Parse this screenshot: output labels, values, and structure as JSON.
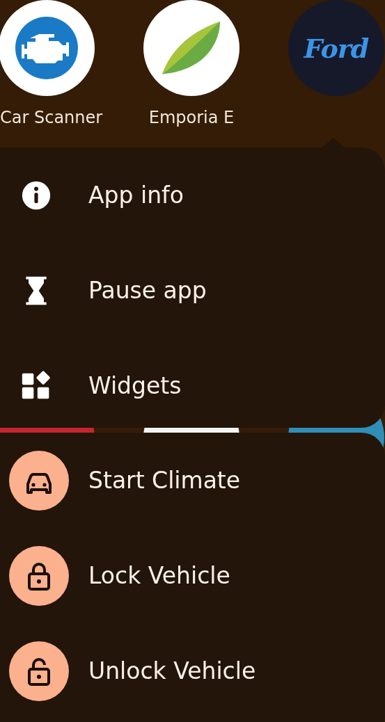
{
  "apps": [
    {
      "label": "Car Scanner"
    },
    {
      "label": "Emporia E"
    },
    {
      "logo_text": "Ford"
    }
  ],
  "menu": {
    "items": [
      {
        "label": "App info"
      },
      {
        "label": "Pause app"
      },
      {
        "label": "Widgets"
      }
    ]
  },
  "shortcuts": {
    "items": [
      {
        "label": "Start Climate"
      },
      {
        "label": "Lock Vehicle"
      },
      {
        "label": "Unlock Vehicle"
      }
    ]
  }
}
